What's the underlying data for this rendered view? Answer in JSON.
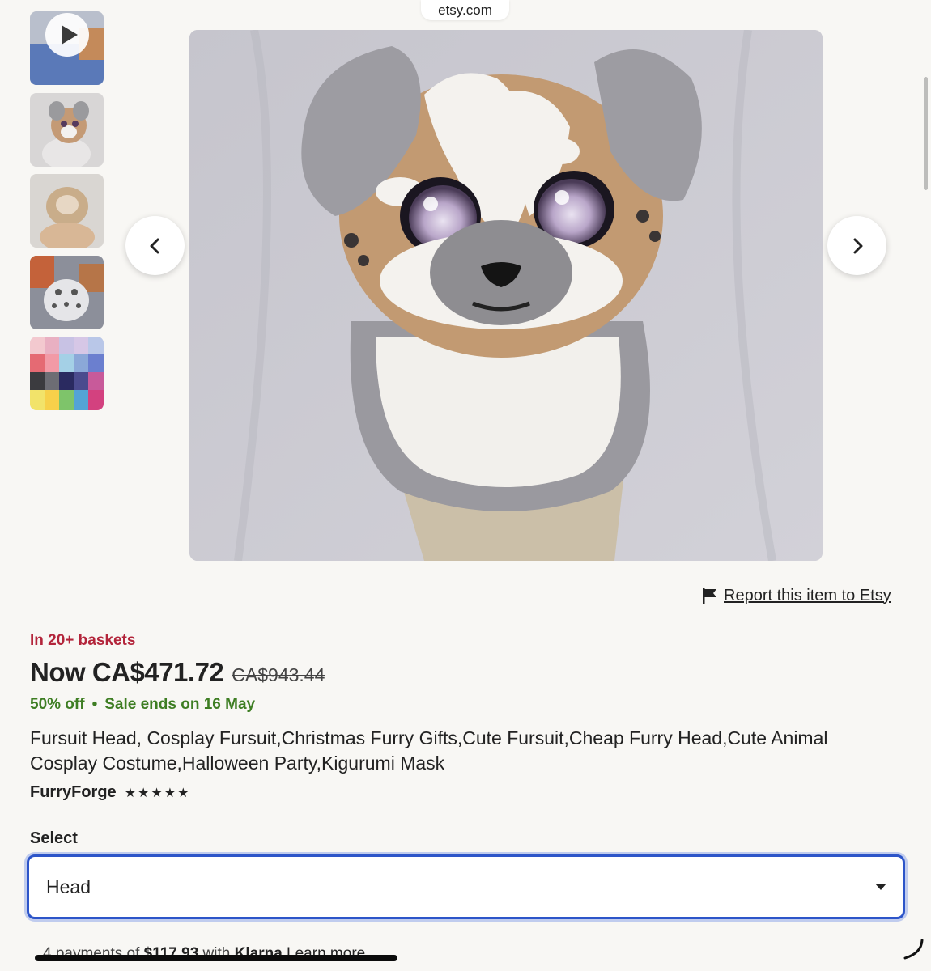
{
  "browser": {
    "url_display": "etsy.com"
  },
  "gallery": {
    "thumbnails": [
      {
        "name": "video-thumbnail",
        "icon": "play-icon"
      },
      {
        "name": "thumbnail-2"
      },
      {
        "name": "thumbnail-3"
      },
      {
        "name": "thumbnail-4"
      },
      {
        "name": "thumbnail-5"
      }
    ],
    "prev_icon": "chevron-left-icon",
    "next_icon": "chevron-right-icon"
  },
  "report": {
    "label": "Report this item to Etsy",
    "icon": "flag-icon"
  },
  "listing": {
    "baskets_text": "In 20+ baskets",
    "price_now": "Now CA$471.72",
    "price_original": "CA$943.44",
    "discount": "50% off",
    "separator": "•",
    "sale_end": "Sale ends on 16 May",
    "title": "Fursuit Head, Cosplay Fursuit,Christmas Furry Gifts,Cute Fursuit,Cheap Furry Head,Cute Animal Cosplay Costume,Halloween Party,Kigurumi Mask",
    "shop_name": "FurryForge",
    "rating_stars": "★★★★★",
    "rating_value": 5
  },
  "variation": {
    "label": "Select",
    "selected": "Head"
  },
  "klarna": {
    "prefix": "4 payments of ",
    "amount": "$117.93",
    "middle": " with ",
    "brand": "Klarna",
    "link": "Learn more"
  },
  "colors": {
    "basket_red": "#b3253b",
    "sale_green": "#3e7e23",
    "focus_blue": "#2d55c9",
    "background": "#f8f7f4"
  }
}
